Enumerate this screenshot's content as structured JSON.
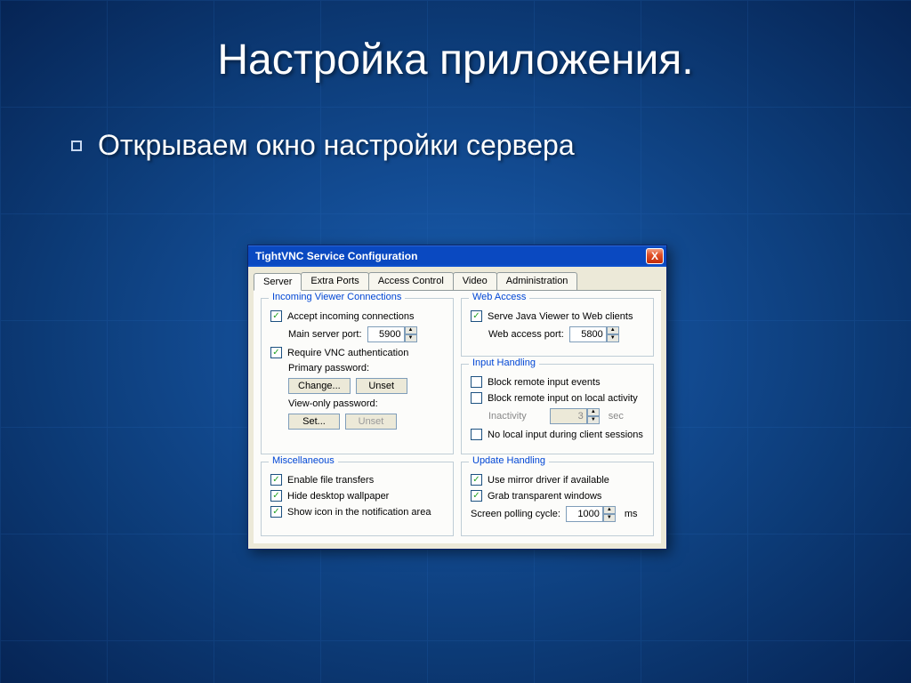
{
  "slide": {
    "title": "Настройка приложения.",
    "bullet": "Открываем окно настройки сервера"
  },
  "dialog": {
    "title": "TightVNC Service Configuration",
    "close_x": "X",
    "tabs": [
      "Server",
      "Extra Ports",
      "Access Control",
      "Video",
      "Administration"
    ],
    "groups": {
      "incoming": {
        "title": "Incoming Viewer Connections",
        "accept": "Accept incoming connections",
        "main_port_label": "Main server port:",
        "main_port": "5900",
        "require_auth": "Require VNC authentication",
        "primary_pw": "Primary password:",
        "change": "Change...",
        "unset": "Unset",
        "viewonly_pw": "View-only password:",
        "set": "Set...",
        "unset2": "Unset"
      },
      "web": {
        "title": "Web Access",
        "serve": "Serve Java Viewer to Web clients",
        "port_label": "Web access port:",
        "port": "5800"
      },
      "input": {
        "title": "Input Handling",
        "block_remote": "Block remote input events",
        "block_local": "Block remote input on local activity",
        "inactivity": "Inactivity",
        "inactivity_val": "3",
        "sec": "sec",
        "nolocal": "No local input during client sessions"
      },
      "misc": {
        "title": "Miscellaneous",
        "filetrans": "Enable file transfers",
        "hidewall": "Hide desktop wallpaper",
        "showicon": "Show icon in the notification area"
      },
      "update": {
        "title": "Update Handling",
        "mirror": "Use mirror driver if available",
        "grab": "Grab transparent windows",
        "poll_label": "Screen polling cycle:",
        "poll_val": "1000",
        "ms": "ms"
      }
    }
  }
}
